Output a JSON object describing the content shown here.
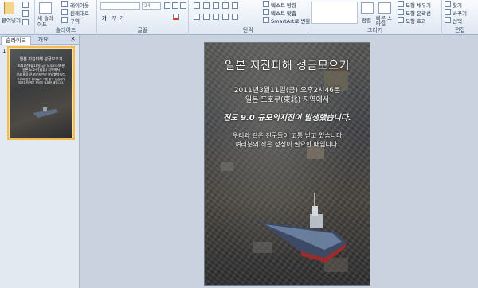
{
  "ribbon": {
    "clipboard": {
      "paste": "붙여넣기",
      "group": ""
    },
    "slides": {
      "new_slide": "새 슬라이드",
      "layout": "레이아웃",
      "reset": "원래대로",
      "section": "구역",
      "group": "슬라이드"
    },
    "font": {
      "size": "24",
      "group": "글꼴"
    },
    "paragraph": {
      "text_direction": "텍스트 방향",
      "align_text": "텍스트 맞춤",
      "smartart": "SmartArt로 변환",
      "group": "단락"
    },
    "drawing": {
      "arrange": "정렬",
      "quick_styles": "빠른 스타일",
      "shape_fill": "도형 채우기",
      "shape_outline": "도형 윤곽선",
      "shape_effects": "도형 효과",
      "group": "그리기"
    },
    "editing": {
      "find": "찾기",
      "replace": "바꾸기",
      "select": "선택",
      "group": "편집"
    }
  },
  "panel": {
    "tab_slides": "슬라이드",
    "tab_outline": "개요",
    "close": "×",
    "slide_number": "1"
  },
  "slide": {
    "title": "일본 지진피해 성금모으기",
    "line1": "2011년3월11일(금) 오후2시46분",
    "line2": "일본 도호쿠(東北) 지역에서",
    "line3": "진도 9.0 규모의지진이 발생했습니다.",
    "line4": "우리와 같은 친구들이 고통 받고 있습니다",
    "line5": "여러분의 작은 정성이 필요한 때입니다."
  }
}
